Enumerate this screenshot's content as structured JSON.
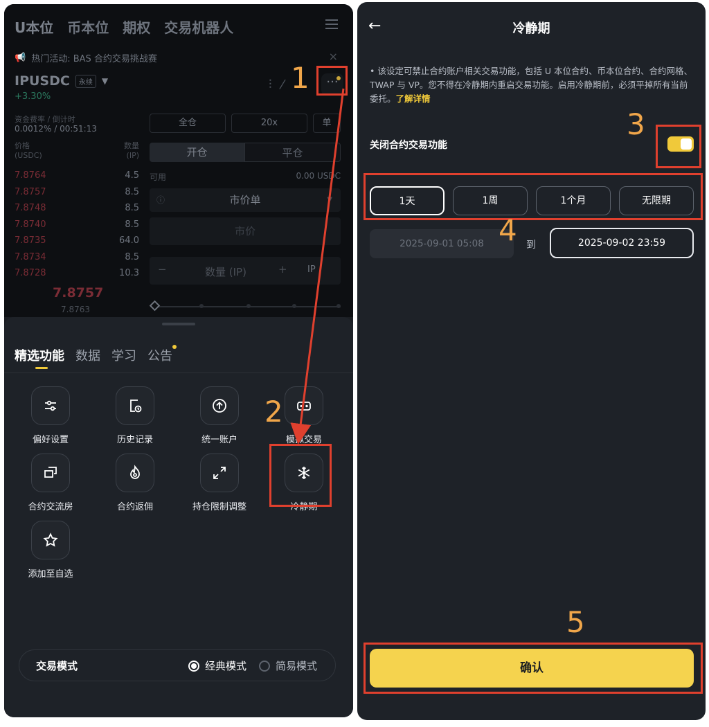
{
  "left": {
    "top_tabs": [
      "U本位",
      "币本位",
      "期权",
      "交易机器人"
    ],
    "promo": "热门活动: BAS 合约交易挑战赛",
    "symbol": "IPUSDC",
    "symbol_tag": "永续",
    "change": "+3.30%",
    "funding_label": "资金费率 / 倒计时",
    "funding_value": "0.0012% / 00:51:13",
    "ob_price_head": "价格",
    "ob_price_unit": "(USDC)",
    "ob_qty_head": "数量",
    "ob_qty_unit": "(IP)",
    "orderbook": [
      {
        "price": "7.8764",
        "qty": "4.5"
      },
      {
        "price": "7.8757",
        "qty": "8.5"
      },
      {
        "price": "7.8748",
        "qty": "8.5"
      },
      {
        "price": "7.8740",
        "qty": "8.5"
      },
      {
        "price": "7.8735",
        "qty": "64.0"
      },
      {
        "price": "7.8734",
        "qty": "8.5"
      },
      {
        "price": "7.8728",
        "qty": "10.3"
      }
    ],
    "last_price": "7.8757",
    "mark_price": "7.8763",
    "margin_mode": "全仓",
    "leverage": "20x",
    "single": "单",
    "open_label": "开仓",
    "close_label": "平仓",
    "avail_label": "可用",
    "avail_value": "0.00 USDC",
    "order_type": "市价单",
    "market_label": "市价",
    "qty_label": "数量 (IP)",
    "qty_unit": "IP",
    "sheet_tabs": [
      "精选功能",
      "数据",
      "学习",
      "公告"
    ],
    "features": [
      {
        "label": "偏好设置",
        "icon": "sliders-icon"
      },
      {
        "label": "历史记录",
        "icon": "history-icon"
      },
      {
        "label": "统一账户",
        "icon": "upload-circle-icon"
      },
      {
        "label": "模拟交易",
        "icon": "gamepad-icon"
      },
      {
        "label": "合约交流房",
        "icon": "chat-rooms-icon"
      },
      {
        "label": "合约返佣",
        "icon": "flame-icon"
      },
      {
        "label": "持仓限制调整",
        "icon": "expand-arrows-icon"
      },
      {
        "label": "冷静期",
        "icon": "snowflake-icon"
      },
      {
        "label": "添加至自选",
        "icon": "star-icon"
      }
    ],
    "mode_label": "交易模式",
    "mode_classic": "经典模式",
    "mode_simple": "简易模式"
  },
  "right": {
    "title": "冷静期",
    "description": "该设定可禁止合约账户相关交易功能，包括 U 本位合约、币本位合约、合约网格、TWAP 与 VP。您不得在冷静期内重启交易功能。启用冷静期前，必须平掉所有当前委托。",
    "learn_more": "了解详情",
    "toggle_label": "关闭合约交易功能",
    "toggle_on": true,
    "periods": [
      "1天",
      "1周",
      "1个月",
      "无限期"
    ],
    "selected_period": "1天",
    "date_from": "2025-09-01 05:08",
    "date_to_label": "到",
    "date_to": "2025-09-02 23:59",
    "confirm": "确认"
  },
  "annotations": [
    "1",
    "2",
    "3",
    "4",
    "5"
  ],
  "colors": {
    "accent": "#f0c93a",
    "highlight_box": "#e0402e",
    "step_number": "#f0a64a"
  }
}
